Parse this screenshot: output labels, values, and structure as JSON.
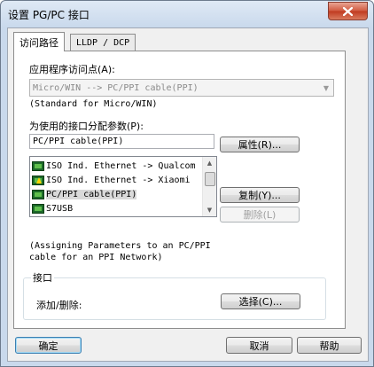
{
  "window": {
    "title": "设置 PG/PC 接口",
    "close_icon": "close-icon"
  },
  "tabs": [
    {
      "label": "访问路径",
      "active": true
    },
    {
      "label": "LLDP / DCP",
      "active": false
    }
  ],
  "access_point": {
    "label": "应用程序访问点(A):",
    "value": "Micro/WIN      --> PC/PPI cable(PPI)",
    "description": "(Standard for Micro/WIN)"
  },
  "interface_param": {
    "label": "为使用的接口分配参数(P):",
    "value": "PC/PPI cable(PPI)"
  },
  "interface_list": {
    "items": [
      {
        "label": "ISO Ind. Ethernet -> Qualcom",
        "icon": "network-adapter-icon",
        "selected": false
      },
      {
        "label": "ISO Ind. Ethernet -> Xiaomi",
        "icon": "network-adapter-warning-icon",
        "selected": false
      },
      {
        "label": "PC/PPI cable(PPI)",
        "icon": "network-adapter-icon",
        "selected": true
      },
      {
        "label": "S7USB",
        "icon": "network-adapter-icon",
        "selected": false
      }
    ]
  },
  "buttons": {
    "properties": "属性(R)...",
    "copy": "复制(Y)...",
    "delete": "删除(L)",
    "select": "选择(C)...",
    "ok": "确定",
    "cancel": "取消",
    "help": "帮助"
  },
  "assign_note": {
    "line1": "(Assigning Parameters to an PC/PPI",
    "line2": "cable for an PPI Network)"
  },
  "interfaces_group": {
    "title": "接口",
    "add_remove_label": "添加/删除:"
  },
  "colors": {
    "title_bar": "#c9d9ec",
    "close_button": "#c8452a",
    "selected_item": "#d9d9d9"
  }
}
